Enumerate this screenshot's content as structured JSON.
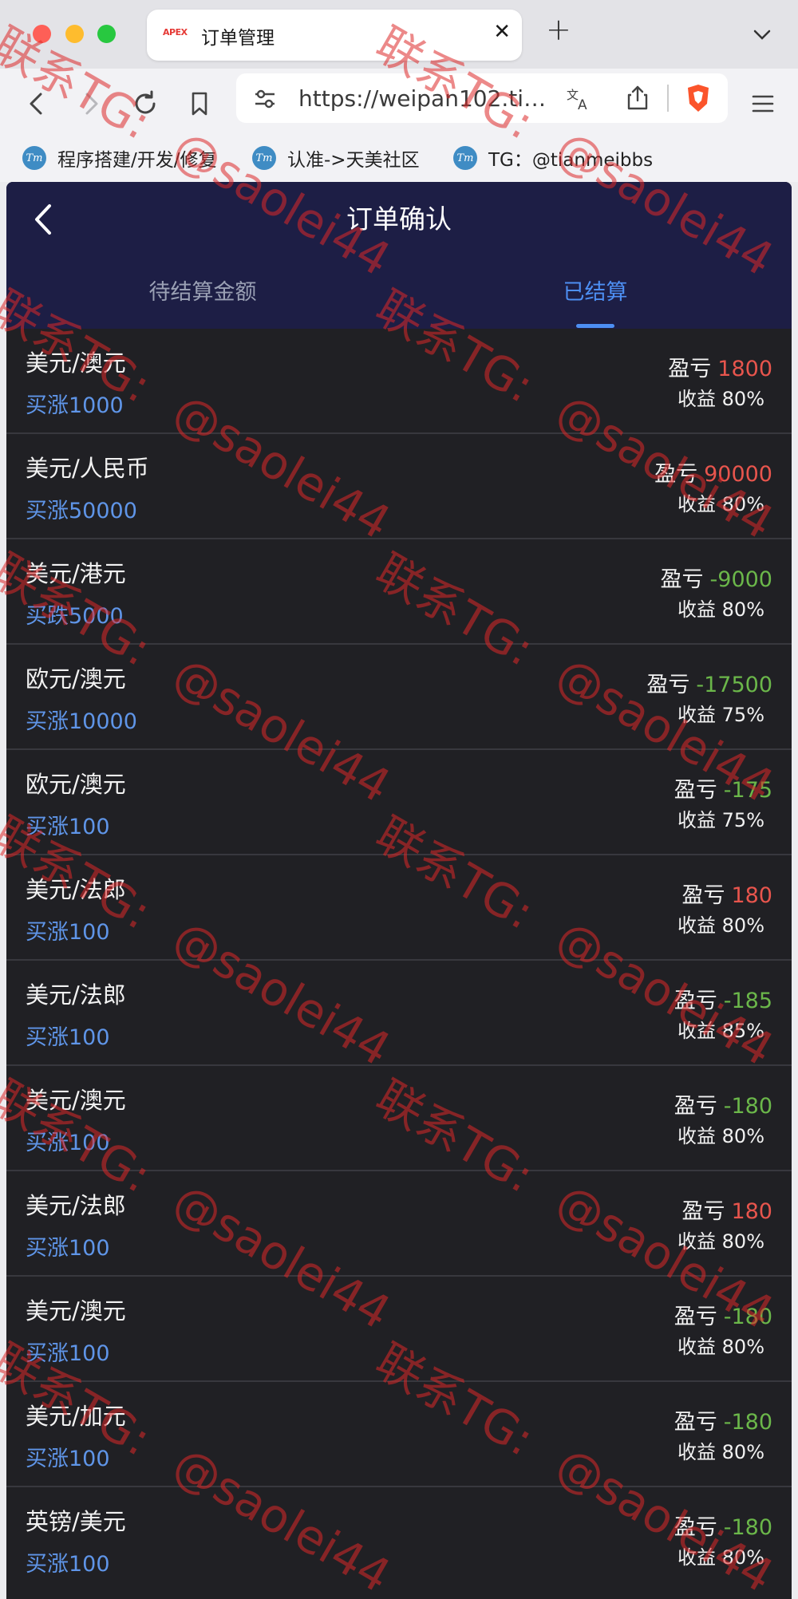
{
  "browser": {
    "tab_favicon_text": "APEX",
    "tab_title": "订单管理",
    "tab_close": "✕",
    "new_tab": "+",
    "url": "https://weipan102.timi...",
    "bookmarks": [
      {
        "label": "程序搭建/开发/修复"
      },
      {
        "label": "认准->天美社区"
      },
      {
        "label": "TG：@tianmeibbs"
      }
    ],
    "bookmark_icon_text": "Tm"
  },
  "app": {
    "title": "订单确认",
    "tabs": [
      {
        "label": "待结算金额",
        "active": false
      },
      {
        "label": "已结算",
        "active": true
      }
    ],
    "pnl_label": "盈亏",
    "yield_label": "收益",
    "orders": [
      {
        "pair": "美元/澳元",
        "side": "买涨1000",
        "pnl": "1800",
        "sign": "pos",
        "yield": "80%"
      },
      {
        "pair": "美元/人民币",
        "side": "买涨50000",
        "pnl": "90000",
        "sign": "pos",
        "yield": "80%"
      },
      {
        "pair": "美元/港元",
        "side": "买跌5000",
        "pnl": "-9000",
        "sign": "neg",
        "yield": "80%"
      },
      {
        "pair": "欧元/澳元",
        "side": "买涨10000",
        "pnl": "-17500",
        "sign": "neg",
        "yield": "75%"
      },
      {
        "pair": "欧元/澳元",
        "side": "买涨100",
        "pnl": "-175",
        "sign": "neg",
        "yield": "75%"
      },
      {
        "pair": "美元/法郎",
        "side": "买涨100",
        "pnl": "180",
        "sign": "pos",
        "yield": "80%"
      },
      {
        "pair": "美元/法郎",
        "side": "买涨100",
        "pnl": "-185",
        "sign": "neg",
        "yield": "85%"
      },
      {
        "pair": "美元/澳元",
        "side": "买涨100",
        "pnl": "-180",
        "sign": "neg",
        "yield": "80%"
      },
      {
        "pair": "美元/法郎",
        "side": "买涨100",
        "pnl": "180",
        "sign": "pos",
        "yield": "80%"
      },
      {
        "pair": "美元/澳元",
        "side": "买涨100",
        "pnl": "-180",
        "sign": "neg",
        "yield": "80%"
      },
      {
        "pair": "美元/加元",
        "side": "买涨100",
        "pnl": "-180",
        "sign": "neg",
        "yield": "80%"
      },
      {
        "pair": "英镑/美元",
        "side": "买涨100",
        "pnl": "-180",
        "sign": "neg",
        "yield": "80%"
      }
    ]
  },
  "watermark": {
    "text_a": "联系TG:",
    "text_b": "@saolei44"
  },
  "colors": {
    "header_bg": "#1d1e45",
    "list_bg": "#202024",
    "accent": "#4d8ff3",
    "profit": "#e8554d",
    "loss": "#6bb74a"
  }
}
